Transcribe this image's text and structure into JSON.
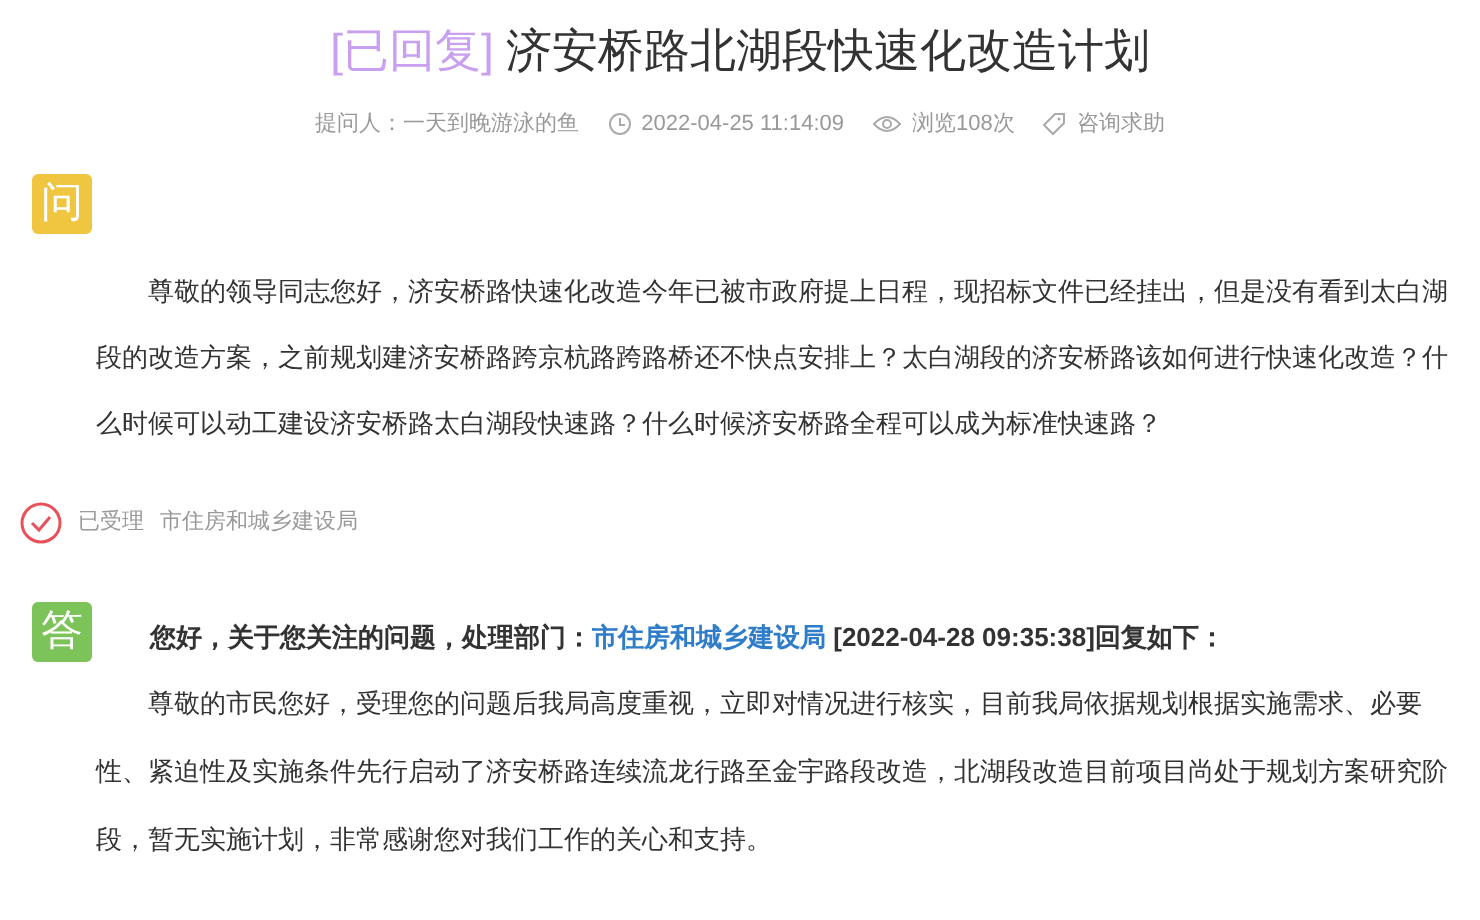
{
  "title": {
    "status": "[已回复]",
    "text": "济安桥路北湖段快速化改造计划"
  },
  "meta": {
    "asker": "提问人：一天到晚游泳的鱼",
    "time": "2022-04-25 11:14:09",
    "views": "浏览108次",
    "category": "咨询求助"
  },
  "question": {
    "badge": "问",
    "text": "尊敬的领导同志您好，济安桥路快速化改造今年已被市政府提上日程，现招标文件已经挂出，但是没有看到太白湖段的改造方案，之前规划建济安桥路跨京杭路跨路桥还不快点安排上？太白湖段的济安桥路该如何进行快速化改造？什么时候可以动工建设济安桥路太白湖段快速路？什么时候济安桥路全程可以成为标准快速路？"
  },
  "status": {
    "label": "已受理",
    "department": "市住房和城乡建设局"
  },
  "answer": {
    "badge": "答",
    "header_before": "您好，关于您关注的问题，处理部门：",
    "department_link": "市住房和城乡建设局",
    "header_after": " [2022-04-28 09:35:38]回复如下：",
    "text": "尊敬的市民您好，受理您的问题后我局高度重视，立即对情况进行核实，目前我局依据规划根据实施需求、必要性、紧迫性及实施条件先行启动了济安桥路连续流龙行路至金宇路段改造，北湖段改造目前项目尚处于规划方案研究阶段，暂无实施计划，非常感谢您对我们工作的关心和支持。"
  }
}
